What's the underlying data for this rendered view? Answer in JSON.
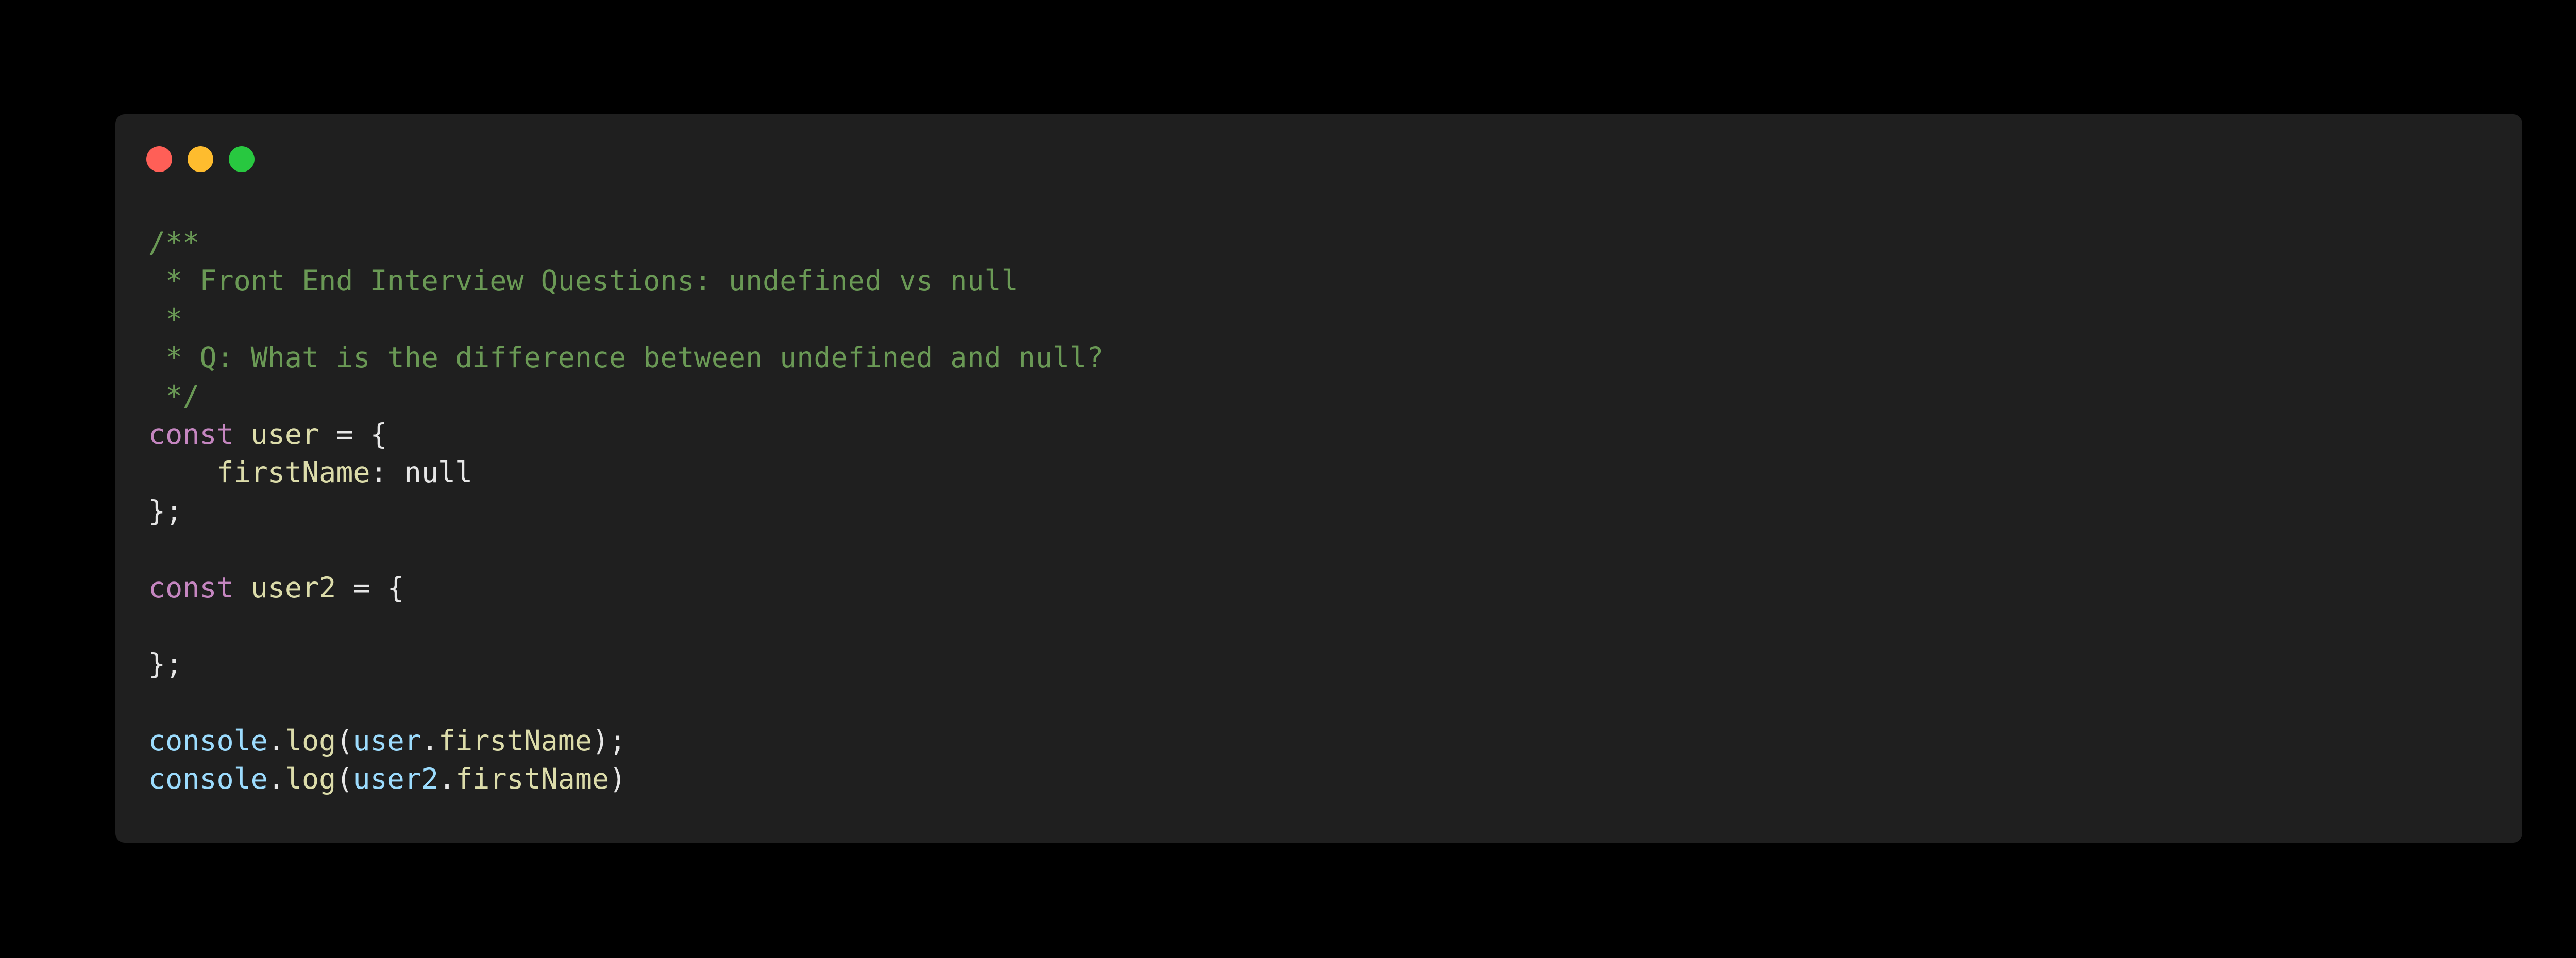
{
  "window": {
    "controls": {
      "close": {
        "icon": "close-dot-icon",
        "color": "#ff5f57"
      },
      "minimize": {
        "icon": "minimize-dot-icon",
        "color": "#febc2e"
      },
      "maximize": {
        "icon": "maximize-dot-icon",
        "color": "#28c840"
      }
    }
  },
  "code": {
    "comment": [
      "/**",
      " * Front End Interview Questions: undefined vs null",
      " *",
      " * Q: What is the difference between undefined and null?",
      " */"
    ],
    "decl1": {
      "keyword": "const",
      "name": "user",
      "open": " = {",
      "prop_indent": "    ",
      "prop_name": "firstName",
      "prop_sep": ": ",
      "prop_value": "null",
      "close": "};"
    },
    "decl2": {
      "keyword": "const",
      "name": "user2",
      "open": " = {",
      "close": "};"
    },
    "log1": {
      "object": "console",
      "dot": ".",
      "method": "log",
      "open": "(",
      "arg_obj": "user",
      "arg_dot": ".",
      "arg_prop": "firstName",
      "close": ");"
    },
    "log2": {
      "object": "console",
      "dot": ".",
      "method": "log",
      "open": "(",
      "arg_obj": "user2",
      "arg_dot": ".",
      "arg_prop": "firstName",
      "close": ")"
    }
  },
  "colors": {
    "background": "#000000",
    "editor_background": "#1f1f1f",
    "comment": "#6a9955",
    "keyword": "#c586c0",
    "identifier": "#dcdcaa",
    "object": "#9cdcfe",
    "text": "#e6e6e6"
  }
}
